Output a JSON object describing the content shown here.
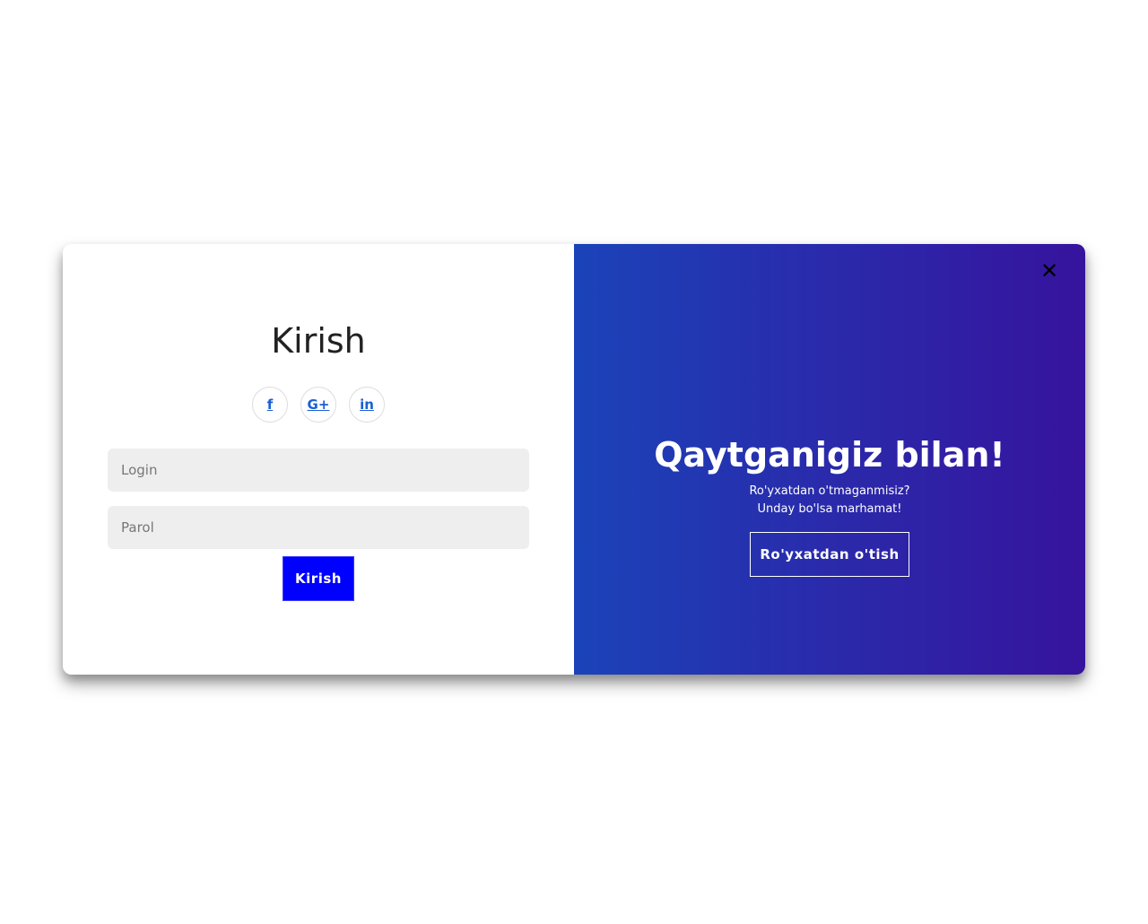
{
  "login_panel": {
    "title": "Kirish",
    "social_buttons": [
      {
        "icon": "facebook-icon",
        "glyph": "f"
      },
      {
        "icon": "google-plus-icon",
        "glyph": "G+"
      },
      {
        "icon": "linkedin-icon",
        "glyph": "in"
      }
    ],
    "login_placeholder": "Login",
    "password_placeholder": "Parol",
    "submit_label": "Kirish"
  },
  "welcome_panel": {
    "close_glyph": "✕",
    "title": "Qaytganigiz bilan!",
    "subtitle_line1": "Ro'yxatdan o'tmaganmisiz?",
    "subtitle_line2": "Unday bo'lsa marhamat!",
    "register_label": "Ro'yxatdan o'tish"
  },
  "colors": {
    "submit_button": "#0000ff",
    "gradient_start": "#1b43b9",
    "gradient_end": "#36139d",
    "social_icon": "#1a5fd4",
    "input_background": "#eeeeee"
  }
}
